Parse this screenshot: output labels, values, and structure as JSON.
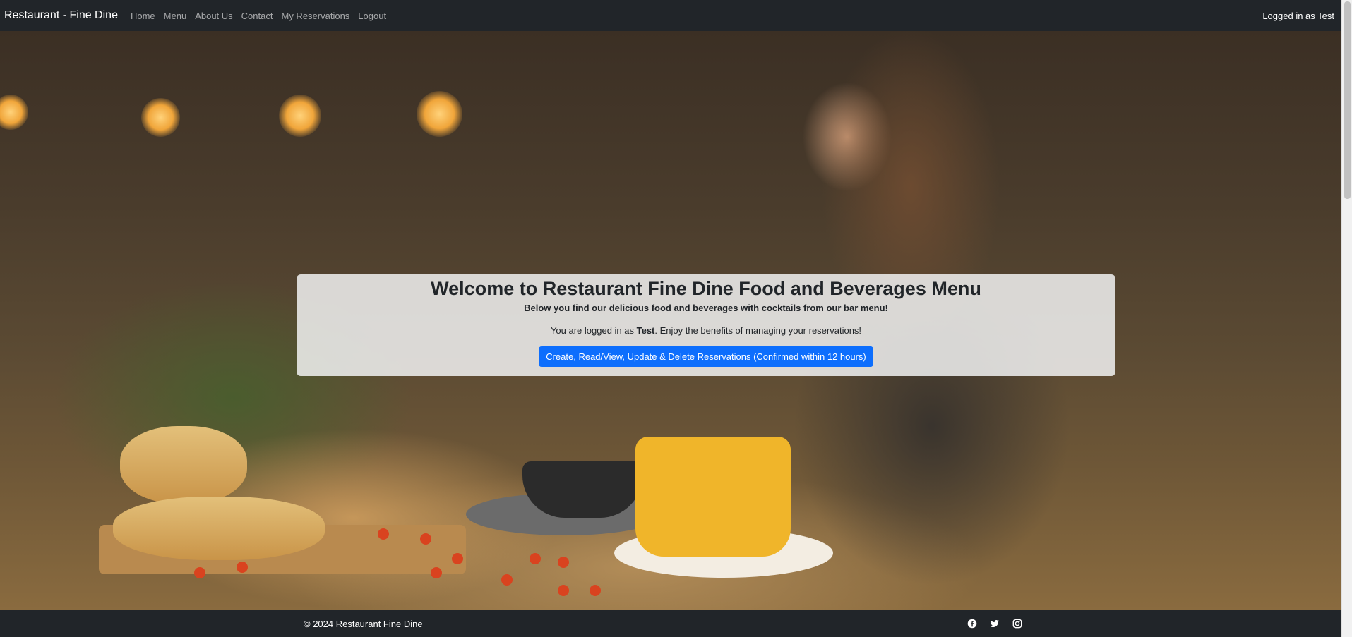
{
  "navbar": {
    "brand": "Restaurant - Fine Dine",
    "links": [
      {
        "label": "Home"
      },
      {
        "label": "Menu"
      },
      {
        "label": "About Us"
      },
      {
        "label": "Contact"
      },
      {
        "label": "My Reservations"
      },
      {
        "label": "Logout"
      }
    ],
    "user_status": "Logged in as Test"
  },
  "welcome": {
    "title": "Welcome to Restaurant Fine Dine Food and Beverages Menu",
    "subtitle": "Below you find our delicious food and beverages with cocktails from our bar menu!",
    "status_prefix": "You are logged in as ",
    "username": "Test",
    "status_suffix": ". Enjoy the benefits of managing your reservations!",
    "cta_label": "Create, Read/View, Update & Delete Reservations (Confirmed within 12 hours)"
  },
  "footer": {
    "copyright": "© 2024 Restaurant Fine Dine",
    "social_icons": [
      "facebook-icon",
      "twitter-icon",
      "instagram-icon"
    ]
  },
  "colors": {
    "navbar_bg": "#212529",
    "primary": "#0d6efd",
    "panel_bg": "#f8f9fa"
  }
}
